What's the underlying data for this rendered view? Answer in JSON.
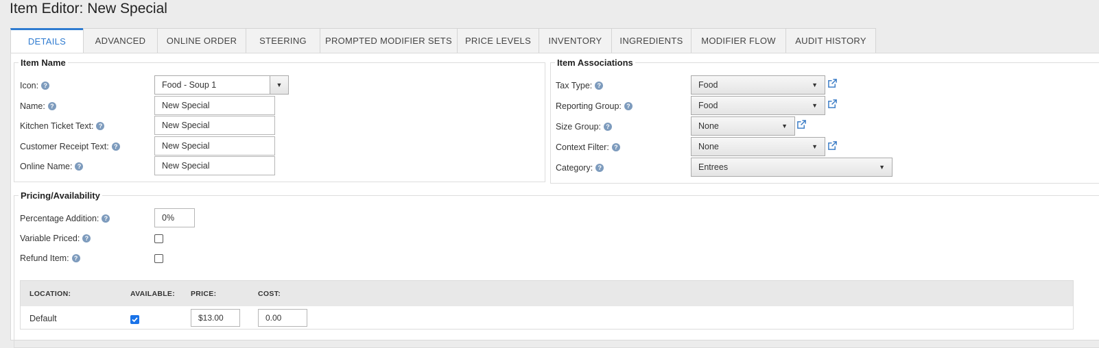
{
  "page": {
    "title": "Item Editor: New Special"
  },
  "tabs": [
    {
      "label": "DETAILS",
      "active": true
    },
    {
      "label": "ADVANCED"
    },
    {
      "label": "ONLINE ORDER"
    },
    {
      "label": "STEERING"
    },
    {
      "label": "PROMPTED MODIFIER SETS"
    },
    {
      "label": "PRICE LEVELS"
    },
    {
      "label": "INVENTORY"
    },
    {
      "label": "INGREDIENTS"
    },
    {
      "label": "MODIFIER FLOW"
    },
    {
      "label": "AUDIT HISTORY"
    }
  ],
  "item_name": {
    "legend": "Item Name",
    "icon": {
      "label": "Icon:",
      "value": "Food - Soup 1"
    },
    "name": {
      "label": "Name:",
      "value": "New Special"
    },
    "kitchen": {
      "label": "Kitchen Ticket Text:",
      "value": "New Special"
    },
    "receipt": {
      "label": "Customer Receipt Text:",
      "value": "New Special"
    },
    "online": {
      "label": "Online Name:",
      "value": "New Special"
    }
  },
  "associations": {
    "legend": "Item Associations",
    "tax": {
      "label": "Tax Type:",
      "value": "Food"
    },
    "reporting": {
      "label": "Reporting Group:",
      "value": "Food"
    },
    "size": {
      "label": "Size Group:",
      "value": "None"
    },
    "context": {
      "label": "Context Filter:",
      "value": "None"
    },
    "category": {
      "label": "Category:",
      "value": "Entrees"
    }
  },
  "pricing": {
    "legend": "Pricing/Availability",
    "percentage": {
      "label": "Percentage Addition:",
      "value": "0%"
    },
    "variable": {
      "label": "Variable Priced:",
      "checked": false
    },
    "refund": {
      "label": "Refund Item:",
      "checked": false
    }
  },
  "locations": {
    "headers": {
      "location": "LOCATION:",
      "available": "AVAILABLE:",
      "price": "PRICE:",
      "cost": "COST:"
    },
    "rows": [
      {
        "location": "Default",
        "available": true,
        "price": "$13.00",
        "cost": "0.00"
      }
    ]
  },
  "colors": {
    "accent": "#2f7bd0",
    "help_icon": "#7d9bbd",
    "checkbox": "#1a73e8"
  }
}
